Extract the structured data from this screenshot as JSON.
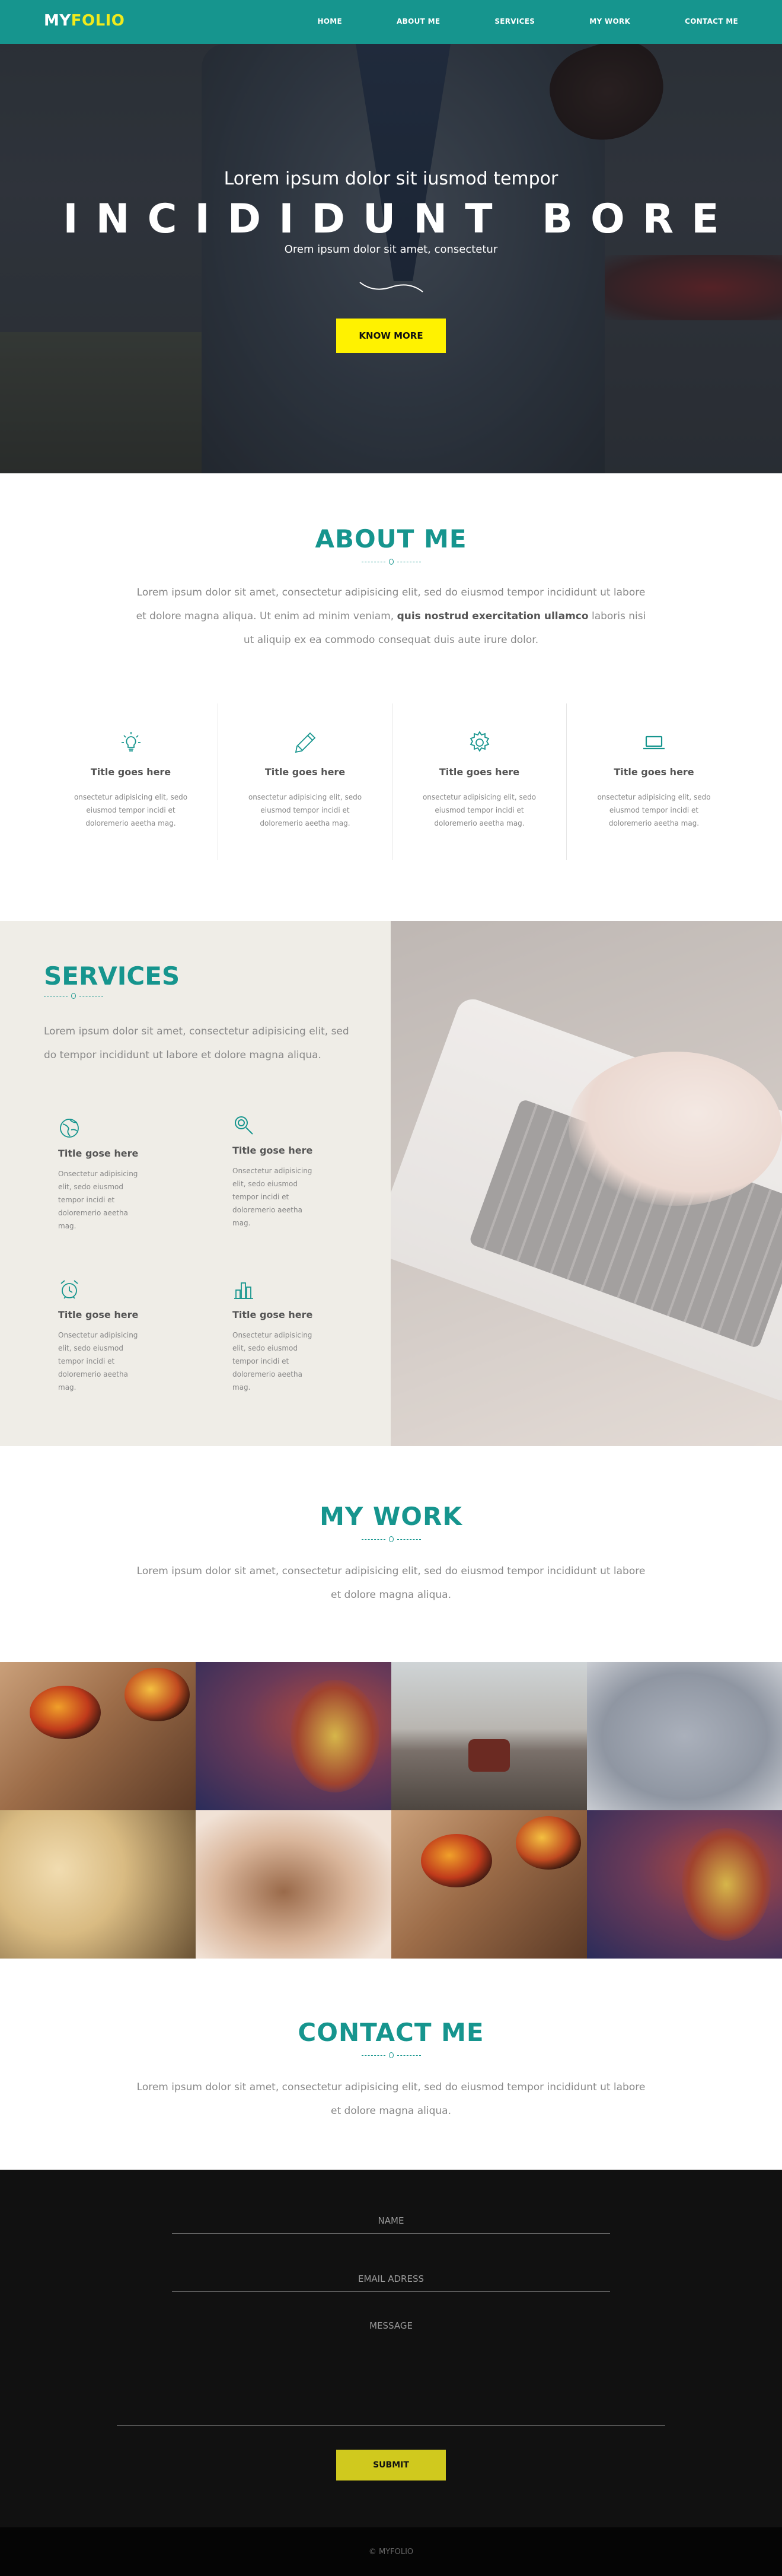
{
  "brand": {
    "part1": "MY",
    "part2": "FOLIO",
    "accent": "#16958e",
    "highlight": "#f1ea1c"
  },
  "nav": {
    "items": [
      {
        "label": "HOME"
      },
      {
        "label": "ABOUT ME"
      },
      {
        "label": "SERVICES"
      },
      {
        "label": "MY WORK"
      },
      {
        "label": "CONTACT ME"
      }
    ]
  },
  "hero": {
    "subtitle": "Lorem ipsum dolor sit iusmod tempor",
    "title": "INCIDIDUNT BORE",
    "tagline": "Orem ipsum dolor sit amet, consectetur",
    "button": "KNOW MORE"
  },
  "about": {
    "title": "ABOUT ME",
    "text_before": "Lorem ipsum dolor sit amet, consectetur adipisicing elit, sed do eiusmod tempor incididunt ut labore et dolore magna aliqua. Ut enim ad minim veniam, ",
    "text_bold": "quis nostrud exercitation ullamco",
    "text_after": " laboris nisi ut aliquip ex ea commodo consequat duis aute irure dolor.",
    "features": [
      {
        "icon": "lightbulb-icon",
        "title": "Title goes here",
        "text": "onsectetur adipisicing elit, sedo eiusmod tempor incidi et doloremerio aeetha mag."
      },
      {
        "icon": "pencil-icon",
        "title": "Title goes here",
        "text": "onsectetur adipisicing elit, sedo eiusmod tempor incidi et doloremerio aeetha mag."
      },
      {
        "icon": "gear-icon",
        "title": "Title goes here",
        "text": "onsectetur adipisicing elit, sedo eiusmod tempor incidi et doloremerio aeetha mag."
      },
      {
        "icon": "laptop-icon",
        "title": "Title goes here",
        "text": "onsectetur adipisicing elit, sedo eiusmod tempor incidi et doloremerio aeetha mag."
      }
    ]
  },
  "services": {
    "title": "SERVICES",
    "text": "Lorem ipsum dolor sit amet, consectetur adipisicing elit, sed do tempor incididunt ut labore et dolore magna aliqua.",
    "items": [
      {
        "icon": "globe-icon",
        "title": "Title gose here",
        "text": "Onsectetur adipisicing elit, sedo eiusmod tempor incidi et doloremerio aeetha mag."
      },
      {
        "icon": "magnifier-icon",
        "title": "Title gose here",
        "text": "Onsectetur adipisicing elit, sedo eiusmod tempor incidi et doloremerio aeetha mag."
      },
      {
        "icon": "alarm-clock-icon",
        "title": "Title gose here",
        "text": "Onsectetur adipisicing elit, sedo eiusmod tempor incidi et doloremerio aeetha mag."
      },
      {
        "icon": "bar-chart-icon",
        "title": "Title gose here",
        "text": "Onsectetur adipisicing elit, sedo eiusmod tempor incidi et doloremerio aeetha mag."
      }
    ]
  },
  "work": {
    "title": "MY WORK",
    "text": "Lorem ipsum dolor sit amet, consectetur adipisicing elit, sed do eiusmod tempor incididunt ut labore et dolore magna aliqua."
  },
  "contact": {
    "title": "CONTACT ME",
    "text": "Lorem ipsum dolor sit amet, consectetur adipisicing elit, sed do eiusmod tempor incididunt ut labore et dolore magna aliqua.",
    "name_placeholder": "NAME",
    "email_placeholder": "EMAIL ADRESS",
    "message_placeholder": "MESSAGE",
    "submit": "SUBMIT"
  },
  "footer": {
    "text": "© MYFOLIO"
  }
}
